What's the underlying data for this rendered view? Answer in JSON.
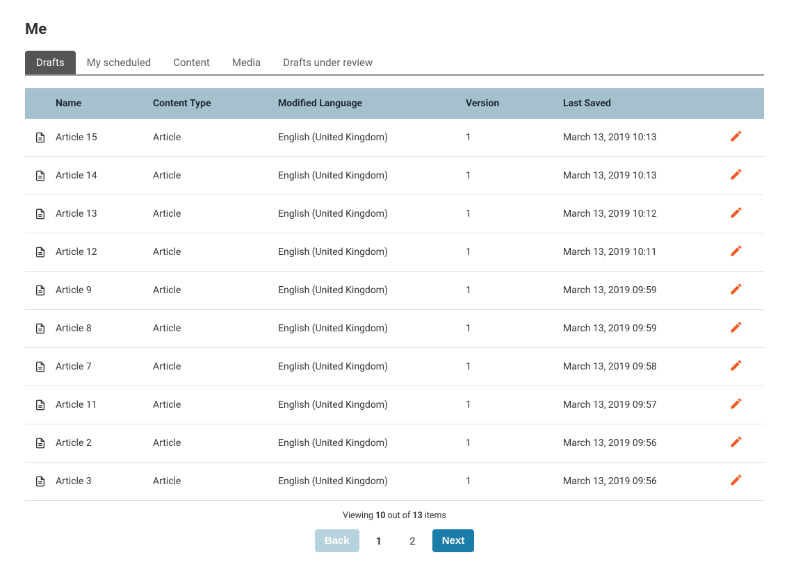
{
  "page_title": "Me",
  "tabs": [
    {
      "label": "Drafts",
      "active": true
    },
    {
      "label": "My scheduled",
      "active": false
    },
    {
      "label": "Content",
      "active": false
    },
    {
      "label": "Media",
      "active": false
    },
    {
      "label": "Drafts under review",
      "active": false
    }
  ],
  "columns": {
    "name": "Name",
    "type": "Content Type",
    "lang": "Modified Language",
    "version": "Version",
    "saved": "Last Saved"
  },
  "rows": [
    {
      "name": "Article 15",
      "type": "Article",
      "lang": "English (United Kingdom)",
      "version": "1",
      "saved": "March 13, 2019 10:13"
    },
    {
      "name": "Article 14",
      "type": "Article",
      "lang": "English (United Kingdom)",
      "version": "1",
      "saved": "March 13, 2019 10:13"
    },
    {
      "name": "Article 13",
      "type": "Article",
      "lang": "English (United Kingdom)",
      "version": "1",
      "saved": "March 13, 2019 10:12"
    },
    {
      "name": "Article 12",
      "type": "Article",
      "lang": "English (United Kingdom)",
      "version": "1",
      "saved": "March 13, 2019 10:11"
    },
    {
      "name": "Article 9",
      "type": "Article",
      "lang": "English (United Kingdom)",
      "version": "1",
      "saved": "March 13, 2019 09:59"
    },
    {
      "name": "Article 8",
      "type": "Article",
      "lang": "English (United Kingdom)",
      "version": "1",
      "saved": "March 13, 2019 09:59"
    },
    {
      "name": "Article 7",
      "type": "Article",
      "lang": "English (United Kingdom)",
      "version": "1",
      "saved": "March 13, 2019 09:58"
    },
    {
      "name": "Article 11",
      "type": "Article",
      "lang": "English (United Kingdom)",
      "version": "1",
      "saved": "March 13, 2019 09:57"
    },
    {
      "name": "Article 2",
      "type": "Article",
      "lang": "English (United Kingdom)",
      "version": "1",
      "saved": "March 13, 2019 09:56"
    },
    {
      "name": "Article 3",
      "type": "Article",
      "lang": "English (United Kingdom)",
      "version": "1",
      "saved": "March 13, 2019 09:56"
    }
  ],
  "footer": {
    "viewing_prefix": "Viewing ",
    "shown": "10",
    "out_of": " out of ",
    "total": "13",
    "items_suffix": " items"
  },
  "pagination": {
    "back": "Back",
    "pages": [
      "1",
      "2"
    ],
    "current": 0,
    "next": "Next"
  }
}
